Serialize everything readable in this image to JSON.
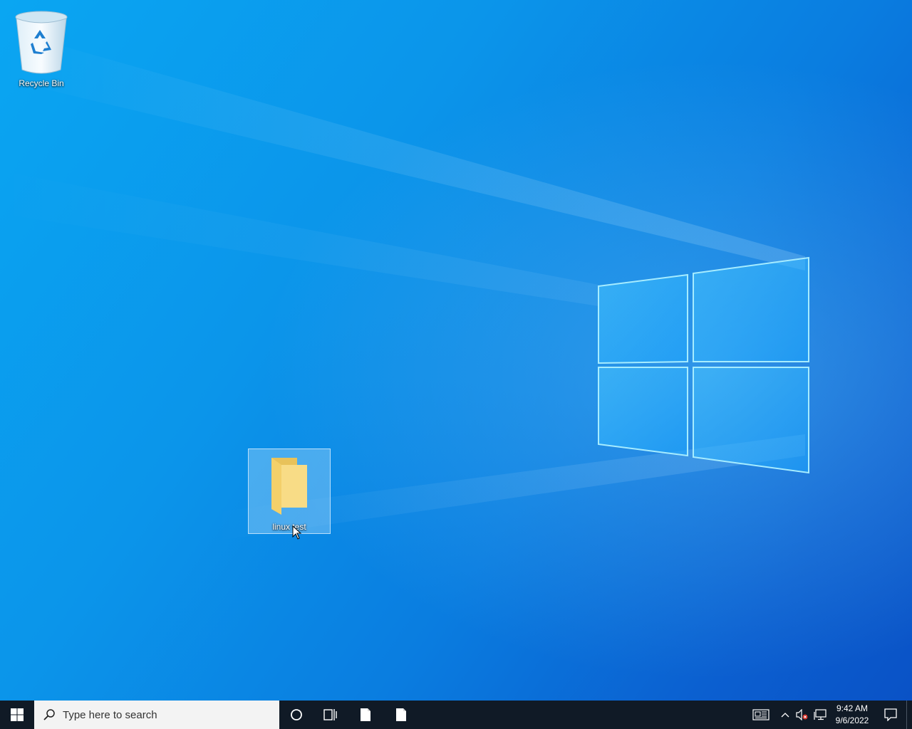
{
  "desktop": {
    "icons": [
      {
        "label": "Recycle Bin",
        "icon": "recycle-bin-icon"
      },
      {
        "label": "linux test",
        "icon": "folder-icon",
        "selected": true
      }
    ]
  },
  "taskbar": {
    "start_icon": "windows-start-icon",
    "search": {
      "placeholder": "Type here to search",
      "icon": "search-icon"
    },
    "cortana_icon": "cortana-circle-icon",
    "taskview_icon": "task-view-icon",
    "pinned_apps": [
      {
        "icon": "document-icon"
      },
      {
        "icon": "document-icon"
      }
    ],
    "tray": {
      "icons": [
        "news-icon",
        "chevron-up-icon",
        "volume-muted-icon",
        "network-icon"
      ],
      "time": "9:42 AM",
      "date": "9/6/2022",
      "notification_icon": "notification-icon"
    }
  },
  "colors": {
    "taskbar": "#101a26",
    "desktop_accent": "#0a8ee8"
  }
}
